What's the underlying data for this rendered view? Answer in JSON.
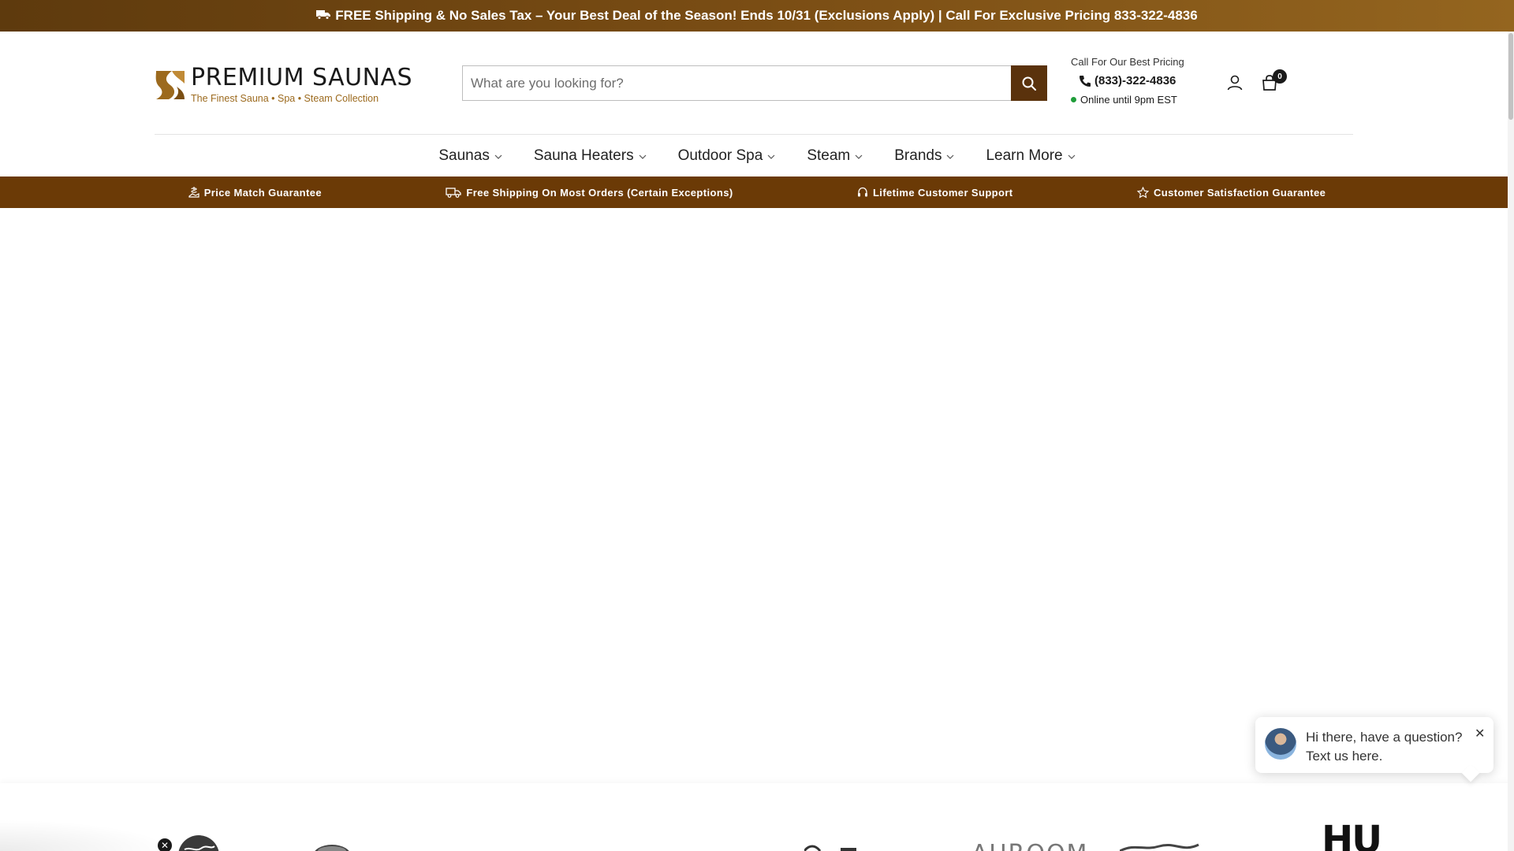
{
  "announcement": {
    "text": "FREE Shipping & No Sales Tax – Your Best Deal of the Season! Ends 10/31 (Exclusions Apply) | Call For Exclusive Pricing 833-322-4836",
    "icon": "truck-icon"
  },
  "logo": {
    "name": "PREMIUM SAUNAS",
    "tagline": "The Finest Sauna • Spa • Steam Collection",
    "brand_color": "#9c6a1e"
  },
  "search": {
    "placeholder": "What are you looking for?",
    "value": ""
  },
  "contact": {
    "label": "Call For Our Best Pricing",
    "phone": "(833)-322-4836",
    "status": "Online until 9pm EST",
    "status_color": "#1f9d3a"
  },
  "cart": {
    "count": "0"
  },
  "nav": {
    "items": [
      {
        "label": "Saunas"
      },
      {
        "label": "Sauna Heaters"
      },
      {
        "label": "Outdoor Spa"
      },
      {
        "label": "Steam"
      },
      {
        "label": "Brands"
      },
      {
        "label": "Learn More"
      }
    ]
  },
  "trust_bar": {
    "color": "#6b3a06",
    "items": [
      {
        "label": "Price Match Guarantee",
        "icon": "price-tag-icon"
      },
      {
        "label": "Free Shipping On Most Orders (Certain Exceptions)",
        "icon": "truck-icon"
      },
      {
        "label": "Lifetime Customer Support",
        "icon": "headset-icon"
      },
      {
        "label": "Customer Satisfaction Guarantee",
        "icon": "star-icon"
      }
    ]
  },
  "chat": {
    "line1": "Hi there, have a question?",
    "line2": "Text us here."
  },
  "brands": {
    "logos": [
      "AUROOM",
      "HU"
    ]
  }
}
